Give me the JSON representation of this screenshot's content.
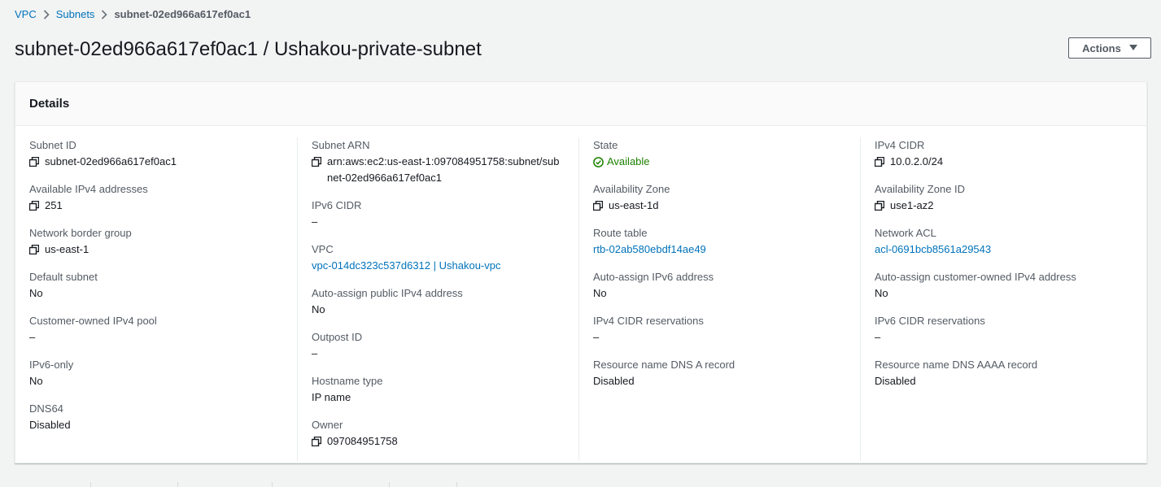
{
  "breadcrumb": {
    "vpc": "VPC",
    "subnets": "Subnets",
    "current": "subnet-02ed966a617ef0ac1"
  },
  "title": "subnet-02ed966a617ef0ac1 / Ushakou-private-subnet",
  "actions_label": "Actions",
  "details": {
    "heading": "Details",
    "col1": {
      "subnet_id": {
        "label": "Subnet ID",
        "value": "subnet-02ed966a617ef0ac1"
      },
      "available_ipv4": {
        "label": "Available IPv4 addresses",
        "value": "251"
      },
      "network_border_group": {
        "label": "Network border group",
        "value": "us-east-1"
      },
      "default_subnet": {
        "label": "Default subnet",
        "value": "No"
      },
      "customer_owned_pool": {
        "label": "Customer-owned IPv4 pool",
        "value": "–"
      },
      "ipv6_only": {
        "label": "IPv6-only",
        "value": "No"
      },
      "dns64": {
        "label": "DNS64",
        "value": "Disabled"
      }
    },
    "col2": {
      "subnet_arn": {
        "label": "Subnet ARN",
        "value": "arn:aws:ec2:us-east-1:097084951758:subnet/subnet-02ed966a617ef0ac1"
      },
      "ipv6_cidr": {
        "label": "IPv6 CIDR",
        "value": "–"
      },
      "vpc": {
        "label": "VPC",
        "value": "vpc-014dc323c537d6312 | Ushakou-vpc"
      },
      "auto_public_ipv4": {
        "label": "Auto-assign public IPv4 address",
        "value": "No"
      },
      "outpost_id": {
        "label": "Outpost ID",
        "value": "–"
      },
      "hostname_type": {
        "label": "Hostname type",
        "value": "IP name"
      },
      "owner": {
        "label": "Owner",
        "value": "097084951758"
      }
    },
    "col3": {
      "state": {
        "label": "State",
        "value": "Available"
      },
      "az": {
        "label": "Availability Zone",
        "value": "us-east-1d"
      },
      "route_table": {
        "label": "Route table",
        "value": "rtb-02ab580ebdf14ae49"
      },
      "auto_ipv6": {
        "label": "Auto-assign IPv6 address",
        "value": "No"
      },
      "ipv4_cidr_res": {
        "label": "IPv4 CIDR reservations",
        "value": "–"
      },
      "dns_a": {
        "label": "Resource name DNS A record",
        "value": "Disabled"
      }
    },
    "col4": {
      "ipv4_cidr": {
        "label": "IPv4 CIDR",
        "value": "10.0.2.0/24"
      },
      "az_id": {
        "label": "Availability Zone ID",
        "value": "use1-az2"
      },
      "network_acl": {
        "label": "Network ACL",
        "value": "acl-0691bcb8561a29543"
      },
      "auto_customer_ipv4": {
        "label": "Auto-assign customer-owned IPv4 address",
        "value": "No"
      },
      "ipv6_cidr_res": {
        "label": "IPv6 CIDR reservations",
        "value": "–"
      },
      "dns_aaaa": {
        "label": "Resource name DNS AAAA record",
        "value": "Disabled"
      }
    }
  },
  "colors": {
    "link": "#0073bb",
    "success": "#1d8102",
    "label": "#545b64"
  },
  "icons": {
    "copy": "copy-icon",
    "status": "status-available-icon",
    "breadcrumb_sep": "chevron-right-icon",
    "dropdown": "caret-down-icon"
  }
}
